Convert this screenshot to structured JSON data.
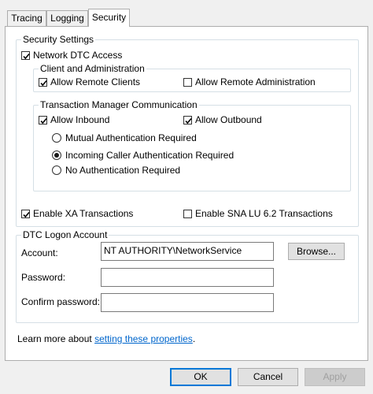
{
  "tabs": [
    {
      "label": "Tracing",
      "active": false
    },
    {
      "label": "Logging",
      "active": false
    },
    {
      "label": "Security",
      "active": true
    }
  ],
  "security_settings": {
    "legend": "Security Settings",
    "network_dtc_access": {
      "label": "Network DTC Access",
      "checked": true
    },
    "client_admin": {
      "legend": "Client and Administration",
      "allow_remote_clients": {
        "label": "Allow Remote Clients",
        "checked": true
      },
      "allow_remote_admin": {
        "label": "Allow Remote Administration",
        "checked": false
      }
    },
    "tm_communication": {
      "legend": "Transaction Manager Communication",
      "allow_inbound": {
        "label": "Allow Inbound",
        "checked": true
      },
      "allow_outbound": {
        "label": "Allow Outbound",
        "checked": true
      },
      "auth_options": [
        {
          "label": "Mutual Authentication Required",
          "selected": false
        },
        {
          "label": "Incoming Caller Authentication Required",
          "selected": true
        },
        {
          "label": "No Authentication Required",
          "selected": false
        }
      ]
    },
    "enable_xa": {
      "label": "Enable XA Transactions",
      "checked": true
    },
    "enable_sna": {
      "label": "Enable SNA LU 6.2 Transactions",
      "checked": false
    }
  },
  "logon_account": {
    "legend": "DTC Logon Account",
    "account_label": "Account:",
    "account_value": "NT AUTHORITY\\NetworkService",
    "browse_label": "Browse...",
    "password_label": "Password:",
    "password_value": "",
    "confirm_label": "Confirm password:",
    "confirm_value": ""
  },
  "learn_more": {
    "prefix": "Learn more about ",
    "link_text": "setting these properties",
    "suffix": "."
  },
  "buttons": {
    "ok": "OK",
    "cancel": "Cancel",
    "apply": "Apply"
  }
}
